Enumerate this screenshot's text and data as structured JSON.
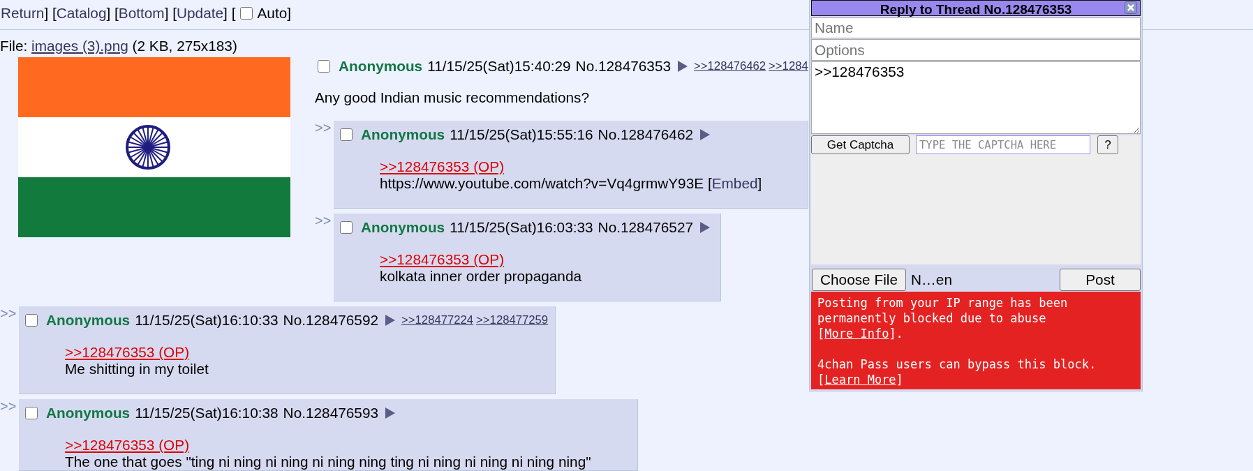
{
  "nav": [
    {
      "kind": "link",
      "text": "Return"
    },
    {
      "kind": "text",
      "text": "] ["
    },
    {
      "kind": "link",
      "text": "Catalog"
    },
    {
      "kind": "text",
      "text": "] ["
    },
    {
      "kind": "link",
      "text": "Bottom"
    },
    {
      "kind": "text",
      "text": "] ["
    },
    {
      "kind": "link",
      "text": "Update"
    },
    {
      "kind": "text",
      "text": "] ["
    },
    {
      "kind": "checkbox",
      "text": "Auto",
      "checked": false
    },
    {
      "kind": "text",
      "text": "]"
    }
  ],
  "file_info": [
    {
      "kind": "text",
      "text": "File: "
    },
    {
      "kind": "link",
      "text": "images (3).png"
    },
    {
      "kind": "text",
      "text": " (2 KB, 275x183)"
    }
  ],
  "op": {
    "checked": false,
    "name": "Anonymous",
    "date": "11/15/25(Sat)15:40:29",
    "number": "No.128476353",
    "backlinks": [
      ">>128476462",
      ">>1284"
    ],
    "comment": [
      {
        "kind": "text",
        "text": "Any good Indian music recommendations?"
      }
    ]
  },
  "replies": [
    {
      "side_arrow": ">>",
      "checked": false,
      "name": "Anonymous",
      "date": "11/15/25(Sat)15:55:16",
      "number": "No.128476462",
      "quote": ">>128476353 (OP)",
      "comment": [
        {
          "kind": "text",
          "text": "https://www.youtube.com/watch?v=Vq4grmwY93E ["
        },
        {
          "kind": "link",
          "text": "Embed"
        },
        {
          "kind": "text",
          "text": "]"
        }
      ]
    },
    {
      "side_arrow": ">>",
      "checked": false,
      "name": "Anonymous",
      "date": "11/15/25(Sat)16:03:33",
      "number": "No.128476527",
      "quote": ">>128476353 (OP)",
      "comment": [
        {
          "kind": "text",
          "text": "kolkata inner order propaganda"
        }
      ]
    },
    {
      "side_arrow": ">>",
      "checked": false,
      "name": "Anonymous",
      "date": "11/15/25(Sat)16:10:33",
      "number": "No.128476592",
      "backlinks": [
        ">>128477224",
        ">>128477259"
      ],
      "quote": ">>128476353 (OP)",
      "comment": [
        {
          "kind": "text",
          "text": "Me shitting in my toilet"
        }
      ]
    },
    {
      "side_arrow": ">>",
      "checked": false,
      "name": "Anonymous",
      "date": "11/15/25(Sat)16:10:38",
      "number": "No.128476593",
      "quote": ">>128476353 (OP)",
      "comment": [
        {
          "kind": "text",
          "text": "The one that goes \"ting ni ning ni ning ni ning ning ting ni ning ni ning ni ning ning\""
        }
      ]
    }
  ],
  "quick_reply": {
    "title": "Reply to Thread No.128476353",
    "name_field": {
      "placeholder": "Name"
    },
    "options_field": {
      "placeholder": "Options"
    },
    "comment_field": {
      "value": ">>128476353"
    },
    "captcha_button": "Get Captcha",
    "captcha_field": {
      "placeholder": "TYPE THE CAPTCHA HERE"
    },
    "help_button": "?",
    "file_button": "Choose File",
    "file_name": "N…en",
    "post_button": "Post",
    "error": [
      [
        {
          "kind": "text",
          "text": "Posting from your IP range has been permanently blocked due to abuse ["
        },
        {
          "kind": "link",
          "text": "More Info"
        },
        {
          "kind": "text",
          "text": "]."
        }
      ],
      [
        {
          "kind": "text",
          "text": "4chan Pass users can bypass this block. ["
        },
        {
          "kind": "link",
          "text": "Learn More"
        },
        {
          "kind": "text",
          "text": "]"
        }
      ]
    ]
  }
}
